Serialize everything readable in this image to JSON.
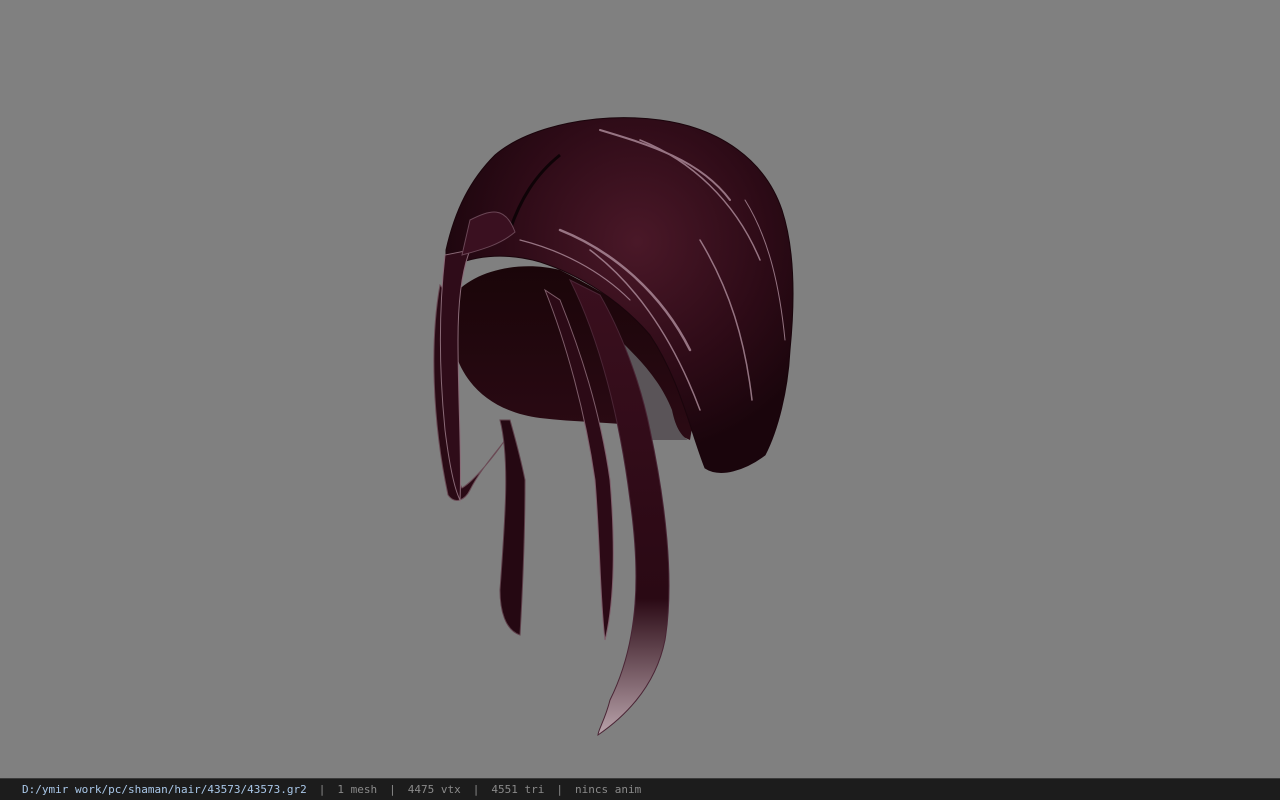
{
  "viewport": {
    "background_color": "#808080",
    "model_name": "hair-mesh",
    "hair_color": "#3b0f1e"
  },
  "status": {
    "file_path": "D:/ymir work/pc/shaman/hair/43573/43573.gr2",
    "mesh_count": "1 mesh",
    "vertex_count": "4475 vtx",
    "triangle_count": "4551 tri",
    "anim_status": "nincs anim",
    "separator": "|"
  }
}
